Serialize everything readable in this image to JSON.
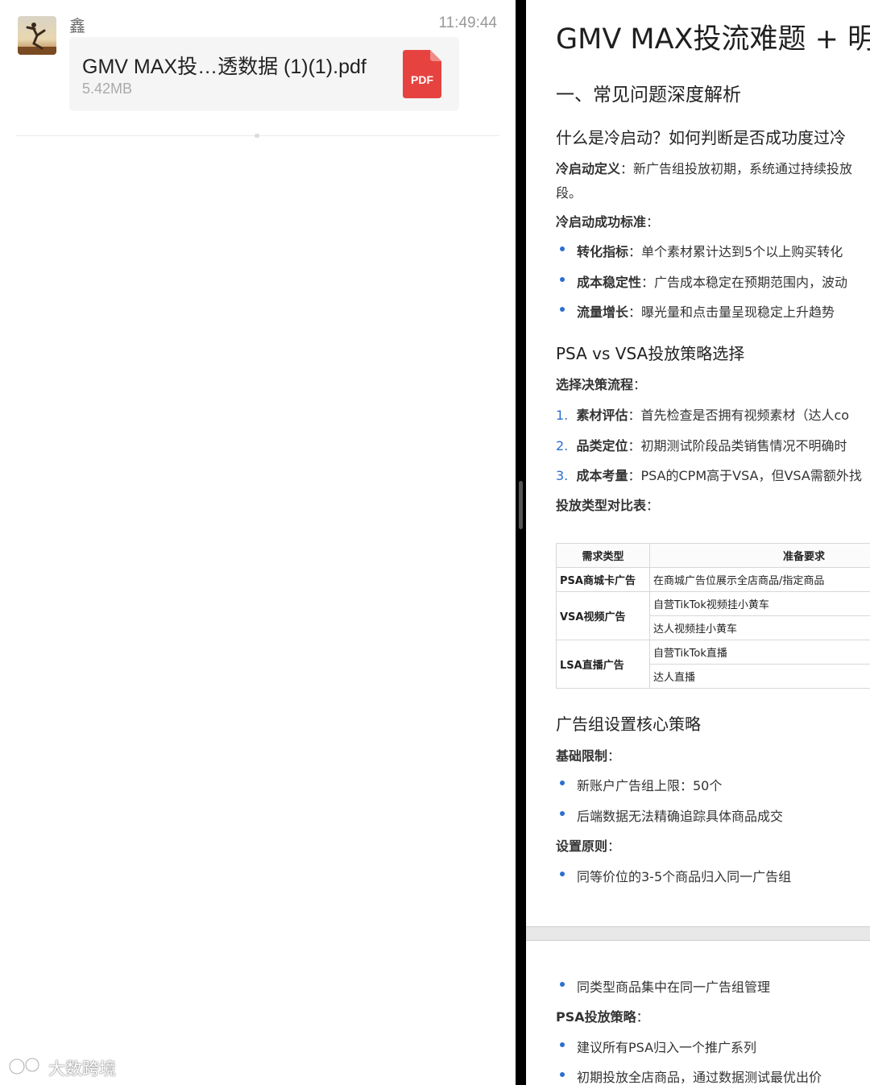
{
  "chat": {
    "sender": "鑫",
    "time": "11:49:44",
    "file": {
      "name": "GMV MAX投…透数据 (1)(1).pdf",
      "size": "5.42MB",
      "icon": "pdf-file-icon",
      "icon_label": "PDF",
      "icon_color": "#e64340"
    }
  },
  "watermark": "大数跨境",
  "doc": {
    "title": "GMV MAX投流难题 + 明",
    "section1": "一、常见问题深度解析",
    "q1": "什么是冷启动？如何判断是否成功度过冷",
    "def_label": "冷启动定义",
    "def_text": "：新广告组投放初期，系统通过持续投放",
    "def_cont": "段。",
    "std_label": "冷启动成功标准",
    "std_colon": "：",
    "std_items": [
      {
        "label": "转化指标",
        "text": "：单个素材累计达到5个以上购买转化"
      },
      {
        "label": "成本稳定性",
        "text": "：广告成本稳定在预期范围内，波动"
      },
      {
        "label": "流量增长",
        "text": "：曝光量和点击量呈现稳定上升趋势"
      }
    ],
    "q2": "PSA vs VSA投放策略选择",
    "flow_label": "选择决策流程",
    "flow_colon": "：",
    "flow_items": [
      {
        "num": "1.",
        "label": "素材评估",
        "text": "：首先检查是否拥有视频素材（达人co"
      },
      {
        "num": "2.",
        "label": "品类定位",
        "text": "：初期测试阶段品类销售情况不明确时"
      },
      {
        "num": "3.",
        "label": "成本考量",
        "text": "：PSA的CPM高于VSA，但VSA需额外找"
      }
    ],
    "table_label": "投放类型对比表",
    "table_colon": "：",
    "table": {
      "headers": [
        "需求类型",
        "准备要求"
      ],
      "groups": [
        {
          "type": "PSA商城卡广告",
          "rows": [
            "在商城广告位展示全店商品/指定商品"
          ]
        },
        {
          "type": "VSA视频广告",
          "rows": [
            "自营TikTok视频挂小黄车",
            "达人视频挂小黄车"
          ]
        },
        {
          "type": "LSA直播广告",
          "rows": [
            "自营TikTok直播",
            "达人直播"
          ]
        }
      ]
    },
    "q3": "广告组设置核心策略",
    "basic_label": "基础限制",
    "basic_colon": "：",
    "basic_items": [
      "新账户广告组上限：50个",
      "后端数据无法精确追踪具体商品成交"
    ],
    "principle_label": "设置原则",
    "principle_colon": "：",
    "principle_items": [
      "同等价位的3-5个商品归入同一广告组"
    ],
    "page2_items": [
      "同类型商品集中在同一广告组管理"
    ],
    "psa_label": "PSA投放策略",
    "psa_colon": "：",
    "psa_items": [
      "建议所有PSA归入一个推广系列",
      "初期投放全店商品，通过数据测试最优出价"
    ]
  }
}
